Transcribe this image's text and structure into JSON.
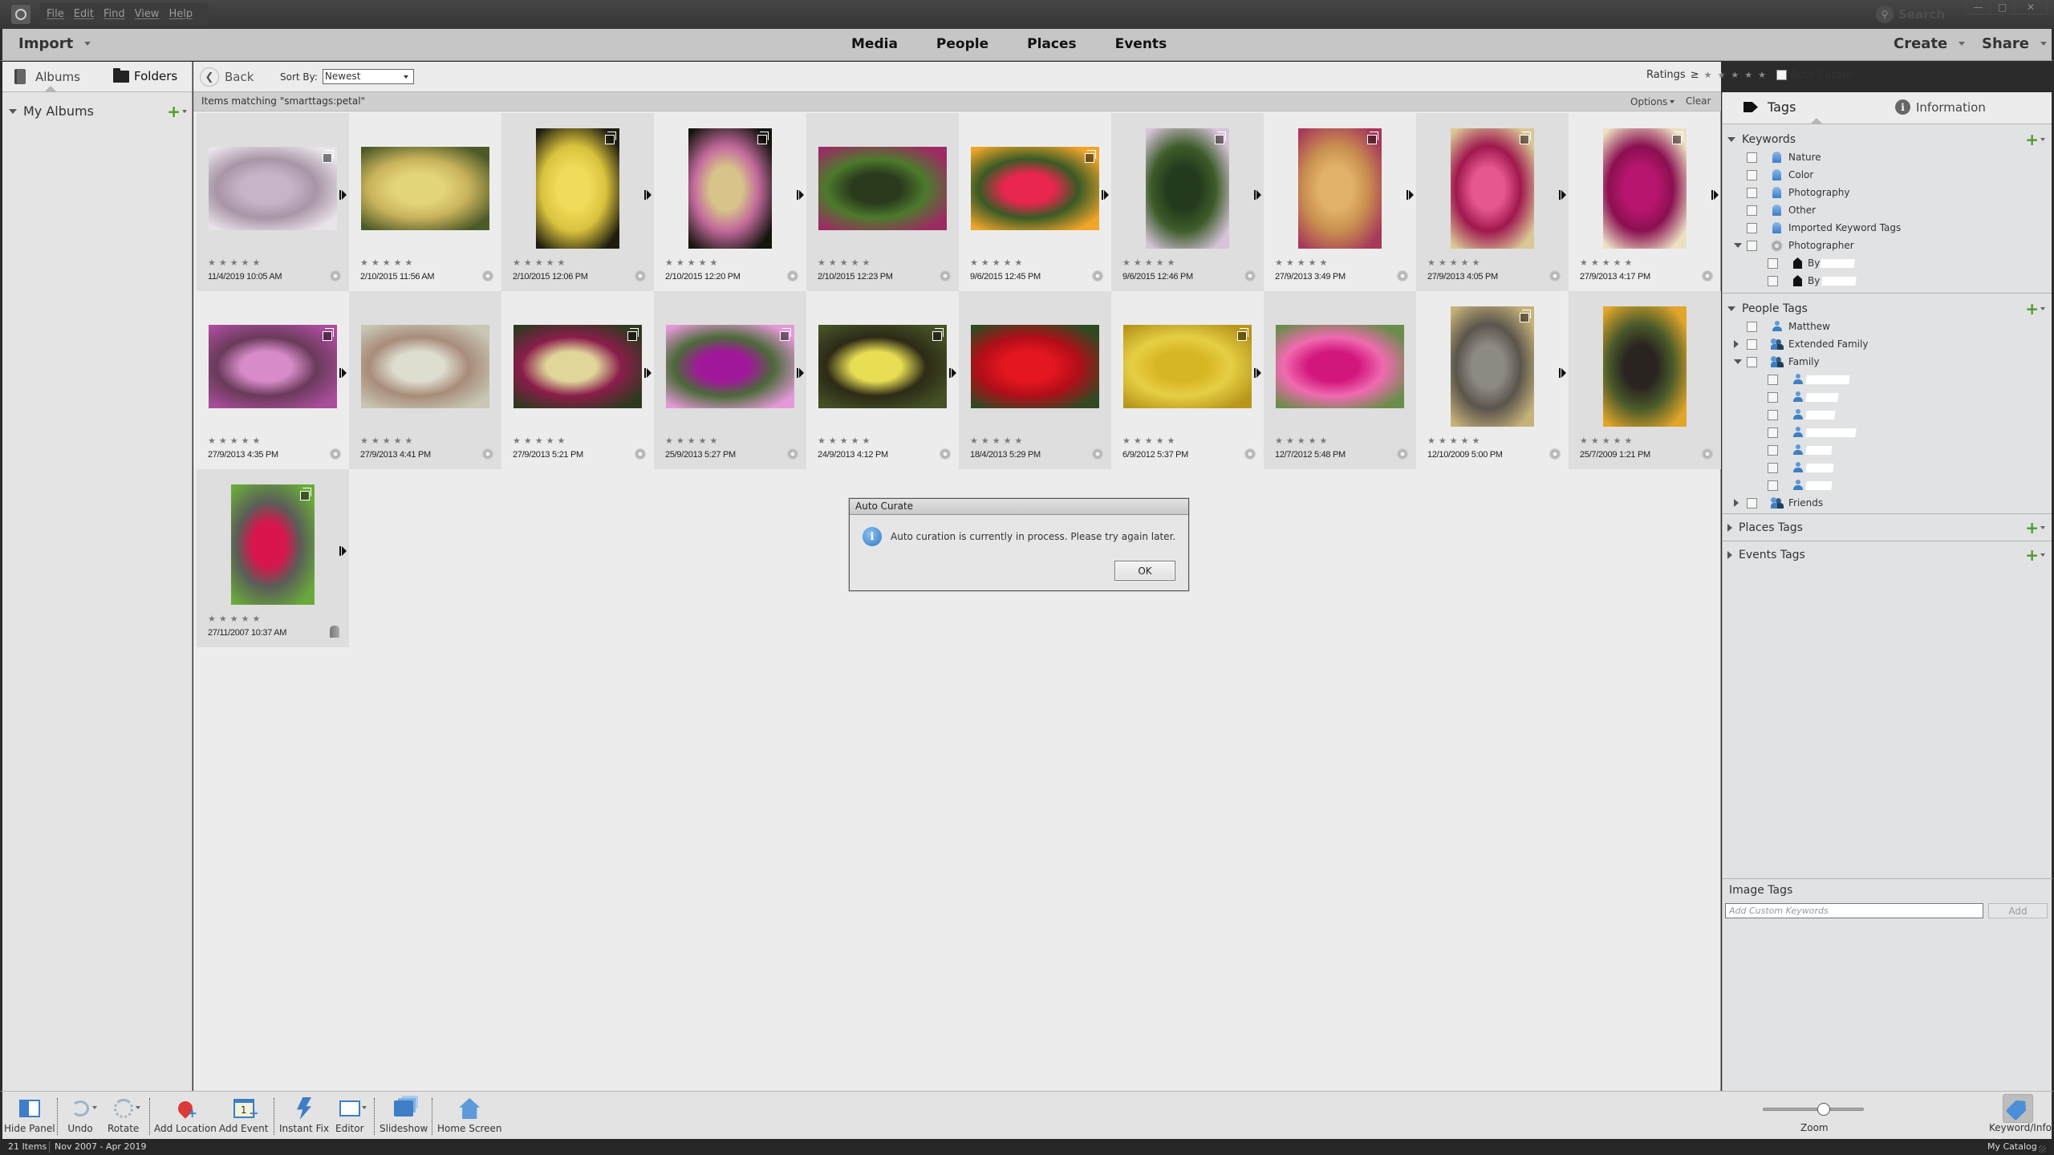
{
  "titlebar": {
    "menus": [
      "File",
      "Edit",
      "Find",
      "View",
      "Help"
    ],
    "search_label": "Search",
    "window_controls": [
      "minimize",
      "maximize",
      "close"
    ]
  },
  "topnav": {
    "import_label": "Import",
    "tabs": [
      "Media",
      "People",
      "Places",
      "Events"
    ],
    "create_label": "Create",
    "share_label": "Share"
  },
  "leftpanel": {
    "tabs": [
      "Albums",
      "Folders"
    ],
    "my_albums_label": "My Albums"
  },
  "gallery_toolbar": {
    "back_label": "Back",
    "sort_by_label": "Sort By:",
    "sort_value": "Newest",
    "ratings_label": "Ratings",
    "ratings_op": "≥",
    "ratings_min_stars": 0,
    "auto_curate_label": "Auto Curate",
    "auto_curate_checked": false
  },
  "match_bar": {
    "text": "Items matching \"smarttags:petal\"",
    "options_label": "Options",
    "clear_label": "Clear"
  },
  "gallery": {
    "items": [
      {
        "date": "11/4/2019 10:05 AM",
        "stack": true,
        "rating": 0,
        "colors": [
          "#c8b4c8",
          "#e9e4ea",
          "#a895a6"
        ],
        "orient": "land"
      },
      {
        "date": "2/10/2015 11:56 AM",
        "stack": false,
        "rating": 0,
        "colors": [
          "#e3d57a",
          "#4c5a27",
          "#c9b35c"
        ],
        "orient": "land"
      },
      {
        "date": "2/10/2015 12:06 PM",
        "stack": true,
        "rating": 0,
        "colors": [
          "#f0dc5a",
          "#1f1d10",
          "#d9c23d"
        ],
        "orient": "port"
      },
      {
        "date": "2/10/2015 12:20 PM",
        "stack": true,
        "rating": 0,
        "colors": [
          "#d8c48a",
          "#151510",
          "#c26a9b"
        ],
        "orient": "port"
      },
      {
        "date": "2/10/2015 12:23 PM",
        "stack": false,
        "rating": 0,
        "colors": [
          "#2a3a1c",
          "#9c2b63",
          "#4d7a2c"
        ],
        "orient": "land"
      },
      {
        "date": "9/6/2015 12:45 PM",
        "stack": true,
        "rating": 0,
        "colors": [
          "#e8264e",
          "#f0a62a",
          "#3a5a25"
        ],
        "orient": "land"
      },
      {
        "date": "9/6/2015 12:46 PM",
        "stack": true,
        "rating": 0,
        "colors": [
          "#243a1c",
          "#d7c4da",
          "#3e5c2a"
        ],
        "orient": "port"
      },
      {
        "date": "27/9/2013 3:49 PM",
        "stack": true,
        "rating": 0,
        "colors": [
          "#e2b26a",
          "#a7395a",
          "#c98f4f"
        ],
        "orient": "port"
      },
      {
        "date": "27/9/2013 4:05 PM",
        "stack": true,
        "rating": 0,
        "colors": [
          "#e6568f",
          "#d9c896",
          "#a0184e"
        ],
        "orient": "port"
      },
      {
        "date": "27/9/2013 4:17 PM",
        "stack": true,
        "rating": 0,
        "colors": [
          "#b8166e",
          "#ece0c2",
          "#8a1051"
        ],
        "orient": "port"
      },
      {
        "date": "27/9/2013 4:35 PM",
        "stack": true,
        "rating": 0,
        "colors": [
          "#d78cc9",
          "#a84d9b",
          "#6a3a5a"
        ],
        "orient": "land"
      },
      {
        "date": "27/9/2013 4:41 PM",
        "stack": false,
        "rating": 0,
        "colors": [
          "#deded0",
          "#c7c7b4",
          "#a88c7a"
        ],
        "orient": "land"
      },
      {
        "date": "27/9/2013 5:21 PM",
        "stack": true,
        "rating": 0,
        "colors": [
          "#e0d69a",
          "#2e3a1f",
          "#8a1d4a"
        ],
        "orient": "land"
      },
      {
        "date": "25/9/2013 5:27 PM",
        "stack": true,
        "rating": 0,
        "colors": [
          "#a1179a",
          "#e59ad8",
          "#4c6a3a"
        ],
        "orient": "land"
      },
      {
        "date": "24/9/2013 4:12 PM",
        "stack": true,
        "rating": 0,
        "colors": [
          "#e8de54",
          "#445226",
          "#2d2a16"
        ],
        "orient": "land"
      },
      {
        "date": "18/4/2013 5:29 PM",
        "stack": false,
        "rating": 0,
        "colors": [
          "#e41620",
          "#2f4a22",
          "#b20e18"
        ],
        "orient": "land"
      },
      {
        "date": "6/9/2012 5:37 PM",
        "stack": true,
        "rating": 0,
        "colors": [
          "#d7b624",
          "#b8961b",
          "#e6cf44"
        ],
        "orient": "land"
      },
      {
        "date": "12/7/2012 5:48 PM",
        "stack": false,
        "rating": 0,
        "colors": [
          "#d2167c",
          "#6a8d4a",
          "#f06ab0"
        ],
        "orient": "land"
      },
      {
        "date": "12/10/2009 5:00 PM",
        "stack": true,
        "rating": 0,
        "colors": [
          "#8d8a84",
          "#c6b27a",
          "#5b554c"
        ],
        "orient": "port"
      },
      {
        "date": "25/7/2009 1:21 PM",
        "stack": false,
        "rating": 0,
        "colors": [
          "#2a2420",
          "#e2a62a",
          "#4a5a2a"
        ],
        "orient": "port"
      },
      {
        "date": "27/11/2007 10:37 AM",
        "stack": true,
        "rating": 0,
        "colors": [
          "#d8154c",
          "#6aaa3a",
          "#5a5e58"
        ],
        "orient": "port",
        "stacked_marker": true
      }
    ]
  },
  "dialog": {
    "title": "Auto Curate",
    "message": "Auto curation is currently in process. Please try again later.",
    "ok_label": "OK"
  },
  "rightpanel": {
    "tabs": [
      "Tags",
      "Information"
    ],
    "keywords": {
      "title": "Keywords",
      "items": [
        "Nature",
        "Color",
        "Photography",
        "Other",
        "Imported Keyword Tags"
      ],
      "photographer": {
        "label": "Photographer",
        "children": [
          "By",
          "By"
        ]
      }
    },
    "people_tags": {
      "title": "People Tags",
      "matthew": "Matthew",
      "extended_family": "Extended Family",
      "family": "Family",
      "family_member_count": 7,
      "friends": "Friends"
    },
    "places_tags_title": "Places Tags",
    "events_tags_title": "Events Tags",
    "image_tags": {
      "title": "Image Tags",
      "input_placeholder": "Add Custom Keywords",
      "input_value": "",
      "add_label": "Add"
    }
  },
  "bottombar": {
    "buttons": [
      "Hide Panel",
      "Undo",
      "Rotate",
      "Add Location",
      "Add Event",
      "Instant Fix",
      "Editor",
      "Slideshow",
      "Home Screen"
    ],
    "zoom_label": "Zoom",
    "zoom_level": 0.6,
    "keyword_info_label": "Keyword/Info"
  },
  "statusbar": {
    "item_count": "21 Items",
    "date_range": "Nov 2007 - Apr 2019",
    "catalog": "My Catalog"
  }
}
